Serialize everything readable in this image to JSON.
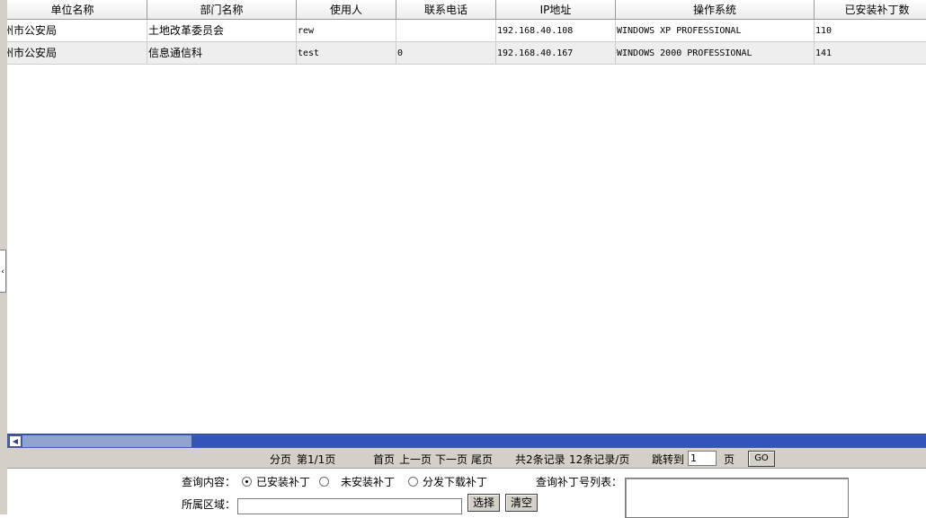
{
  "table": {
    "headers": [
      "单位名称",
      "部门名称",
      "使用人",
      "联系电话",
      "IP地址",
      "操作系统",
      "已安装补丁数"
    ],
    "rows": [
      {
        "unit": "州市公安局",
        "dept": "土地改革委员会",
        "user": "rew",
        "phone": "",
        "ip": "192.168.40.108",
        "os": "WINDOWS XP PROFESSIONAL",
        "patches": "110"
      },
      {
        "unit": "州市公安局",
        "dept": "信息通信科",
        "user": "test",
        "phone": "0",
        "ip": "192.168.40.167",
        "os": "WINDOWS 2000 PROFESSIONAL",
        "patches": "141"
      }
    ]
  },
  "pager": {
    "page_label": "分页",
    "page_info": "第1/1页",
    "first": "首页",
    "prev": "上一页",
    "next": "下一页",
    "last": "尾页",
    "total": "共2条记录",
    "per_page": "12条记录/页",
    "jump_label": "跳转到",
    "jump_value": "1",
    "page_unit": "页",
    "go": "GO"
  },
  "query": {
    "content_label": "查询内容：",
    "options": [
      "已安装补丁",
      "未安装补丁",
      "分发下载补丁"
    ],
    "selected": "已安装补丁",
    "area_label": "所属区域：",
    "area_value": "",
    "select_button": "选择",
    "clear_button": "清空",
    "patch_list_label": "查询补丁号列表："
  },
  "icons": {
    "collapse_handle": "chevron-left-icon",
    "scroll_left": "arrow-left-icon"
  },
  "colors": {
    "scrollbar_track": "#3355bb",
    "scrollbar_thumb": "#8fa3d1",
    "panel": "#d4d0c8"
  }
}
